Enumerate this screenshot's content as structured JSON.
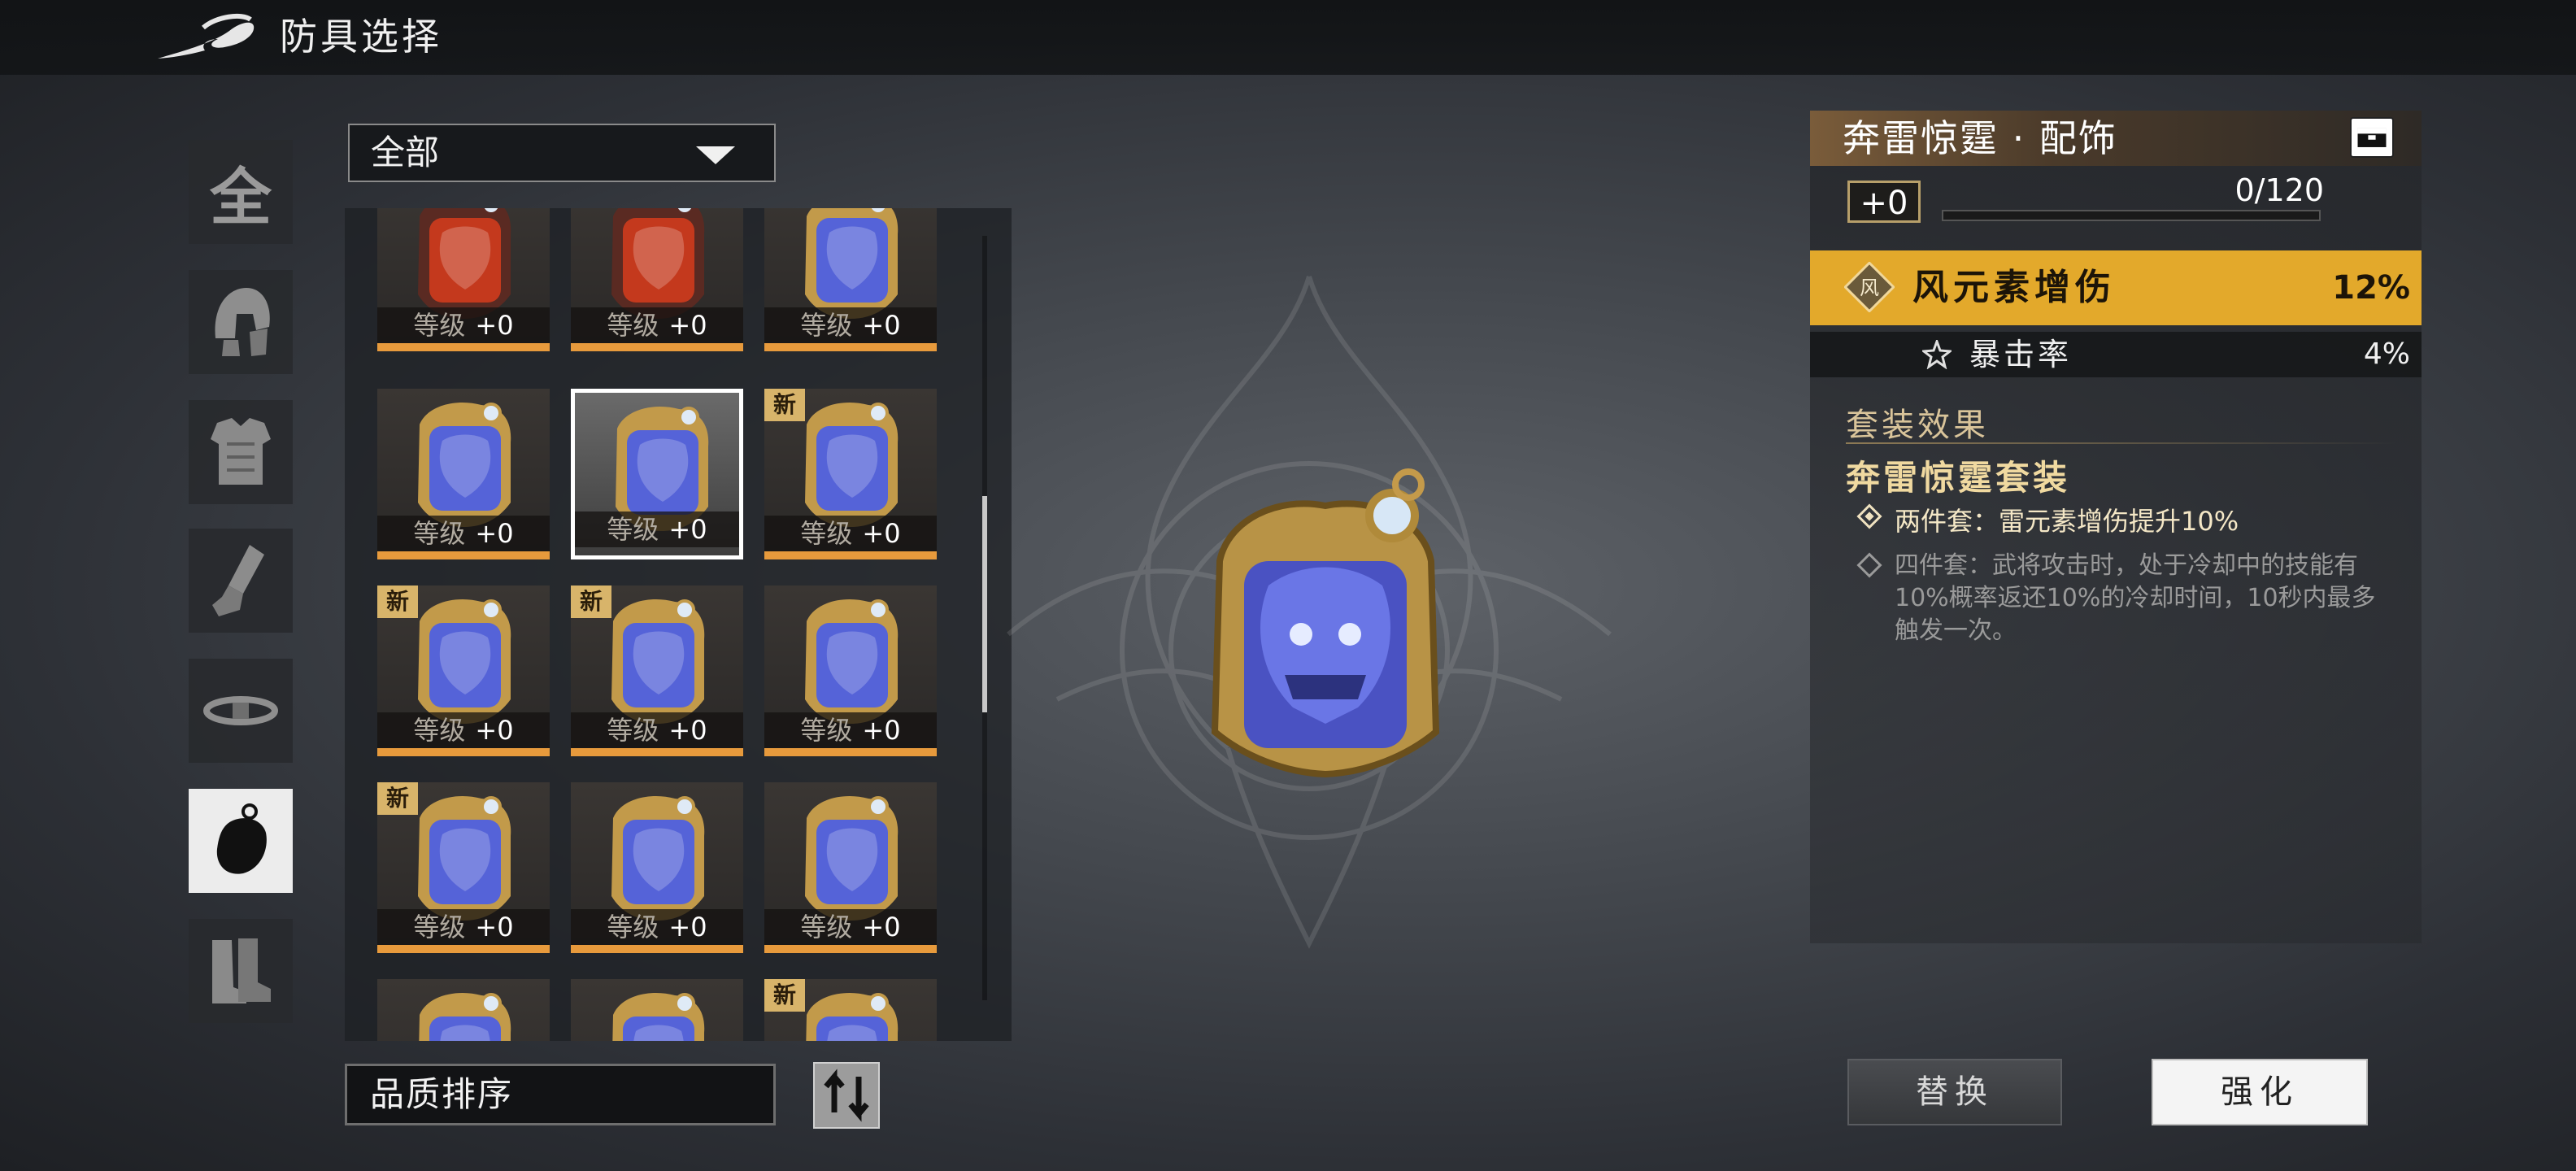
{
  "header": {
    "title": "防具选择",
    "back_icon": "back-arrow-icon"
  },
  "categories": [
    {
      "id": "all",
      "label": "全",
      "icon": "all-text-icon",
      "active": false
    },
    {
      "id": "helmet",
      "icon": "helmet-icon",
      "active": false
    },
    {
      "id": "armor",
      "icon": "chest-armor-icon",
      "active": false
    },
    {
      "id": "gauntlet",
      "icon": "gauntlet-icon",
      "active": false
    },
    {
      "id": "belt",
      "icon": "belt-icon",
      "active": false
    },
    {
      "id": "accessory",
      "icon": "pendant-icon",
      "active": true
    },
    {
      "id": "boots",
      "icon": "boots-icon",
      "active": false
    }
  ],
  "filter": {
    "selected": "全部"
  },
  "grid": {
    "level_label": "等级",
    "new_badge": "新",
    "items": [
      {
        "type": "red",
        "level": "+0",
        "new": false,
        "selected": false
      },
      {
        "type": "red",
        "level": "+0",
        "new": false,
        "selected": false
      },
      {
        "type": "blue",
        "level": "+0",
        "new": false,
        "selected": false
      },
      {
        "type": "blue",
        "level": "+0",
        "new": false,
        "selected": false
      },
      {
        "type": "blue",
        "level": "+0",
        "new": false,
        "selected": true
      },
      {
        "type": "blue",
        "level": "+0",
        "new": true,
        "selected": false
      },
      {
        "type": "blue",
        "level": "+0",
        "new": true,
        "selected": false
      },
      {
        "type": "blue",
        "level": "+0",
        "new": true,
        "selected": false
      },
      {
        "type": "blue",
        "level": "+0",
        "new": false,
        "selected": false
      },
      {
        "type": "blue",
        "level": "+0",
        "new": true,
        "selected": false
      },
      {
        "type": "blue",
        "level": "+0",
        "new": false,
        "selected": false
      },
      {
        "type": "blue",
        "level": "+0",
        "new": false,
        "selected": false
      },
      {
        "type": "blue",
        "level": "",
        "new": false,
        "selected": false
      },
      {
        "type": "blue",
        "level": "",
        "new": false,
        "selected": false
      },
      {
        "type": "blue",
        "level": "",
        "new": true,
        "selected": false
      }
    ]
  },
  "sort": {
    "label": "品质排序",
    "icon": "sort-toggle-icon"
  },
  "detail": {
    "title": "奔雷惊霆 · 配饰",
    "chest_icon": "chest-icon",
    "level": "+0",
    "exp": "0/120",
    "exp_fraction": 0,
    "main_stat": {
      "icon_text": "风",
      "name": "风元素增伤",
      "value": "12%"
    },
    "sub_stat": {
      "icon": "crit-star-icon",
      "name": "暴击率",
      "value": "4%"
    },
    "set_header": "套装效果",
    "set_name": "奔雷惊霆套装",
    "set_two": "两件套：雷元素增伤提升10%",
    "set_four": "四件套：武将攻击时，处于冷却中的技能有10%概率返还10%的冷却时间，10秒内最多触发一次。"
  },
  "buttons": {
    "replace": "替换",
    "upgrade": "强化"
  },
  "colors": {
    "accent_gold": "#e3a92b",
    "level_bar": "#e79a3c",
    "new_badge": "#d8b46a"
  }
}
